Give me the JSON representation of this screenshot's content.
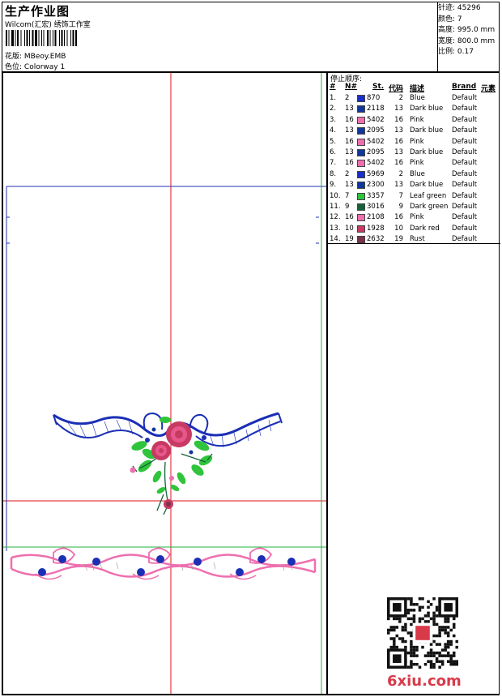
{
  "header": {
    "title": "生产作业图",
    "subtitle": "Wilcom(汇宏) 绣饰工作室",
    "design_label": "花版:",
    "design_value": "MBeoy.EMB",
    "colorway_label": "色位:",
    "colorway_value": "Colorway 1"
  },
  "stats": [
    {
      "label": "针迹:",
      "value": "45296"
    },
    {
      "label": "颜色:",
      "value": "7"
    },
    {
      "label": "高度:",
      "value": "995.0 mm"
    },
    {
      "label": "宽度:",
      "value": "800.0 mm"
    },
    {
      "label": "比例:",
      "value": "0.17"
    }
  ],
  "table": {
    "stop_title": "停止顺序:",
    "columns": {
      "num": "#",
      "needle": "N#",
      "stitches": "St.",
      "code": "代码",
      "desc": "描述",
      "brand": "Brand",
      "element": "元素"
    },
    "rows": [
      {
        "num": "1.",
        "needle": "2",
        "color": "#1a2fc8",
        "stitches": "870",
        "code": "2",
        "desc": "Blue",
        "brand": "Default"
      },
      {
        "num": "2.",
        "needle": "13",
        "color": "#12379a",
        "stitches": "2118",
        "code": "13",
        "desc": "Dark blue",
        "brand": "Default"
      },
      {
        "num": "3.",
        "needle": "16",
        "color": "#ee6fae",
        "stitches": "5402",
        "code": "16",
        "desc": "Pink",
        "brand": "Default"
      },
      {
        "num": "4.",
        "needle": "13",
        "color": "#12379a",
        "stitches": "2095",
        "code": "13",
        "desc": "Dark blue",
        "brand": "Default"
      },
      {
        "num": "5.",
        "needle": "16",
        "color": "#ee6fae",
        "stitches": "5402",
        "code": "16",
        "desc": "Pink",
        "brand": "Default"
      },
      {
        "num": "6.",
        "needle": "13",
        "color": "#12379a",
        "stitches": "2095",
        "code": "13",
        "desc": "Dark blue",
        "brand": "Default"
      },
      {
        "num": "7.",
        "needle": "16",
        "color": "#ee6fae",
        "stitches": "5402",
        "code": "16",
        "desc": "Pink",
        "brand": "Default"
      },
      {
        "num": "8.",
        "needle": "2",
        "color": "#1a2fc8",
        "stitches": "5969",
        "code": "2",
        "desc": "Blue",
        "brand": "Default"
      },
      {
        "num": "9.",
        "needle": "13",
        "color": "#12379a",
        "stitches": "2300",
        "code": "13",
        "desc": "Dark blue",
        "brand": "Default"
      },
      {
        "num": "10.",
        "needle": "7",
        "color": "#2fc43c",
        "stitches": "3357",
        "code": "7",
        "desc": "Leaf green",
        "brand": "Default"
      },
      {
        "num": "11.",
        "needle": "9",
        "color": "#17613a",
        "stitches": "3016",
        "code": "9",
        "desc": "Dark green",
        "brand": "Default"
      },
      {
        "num": "12.",
        "needle": "16",
        "color": "#ee6fae",
        "stitches": "2108",
        "code": "16",
        "desc": "Pink",
        "brand": "Default"
      },
      {
        "num": "13.",
        "needle": "10",
        "color": "#c73a64",
        "stitches": "1928",
        "code": "10",
        "desc": "Dark red",
        "brand": "Default"
      },
      {
        "num": "14.",
        "needle": "19",
        "color": "#7a3347",
        "stitches": "2632",
        "code": "19",
        "desc": "Rust",
        "brand": "Default"
      }
    ]
  },
  "colors": {
    "guide_red": "#e0101a",
    "guide_blue": "#2030b0",
    "guide_green": "#20b040",
    "ribbon_blue": "#1b2fb5",
    "pink": "#ee6fae",
    "rose": "#c73a64",
    "leaf": "#2fc43c",
    "dark_green": "#17613a"
  },
  "watermark": "6xiu.com"
}
